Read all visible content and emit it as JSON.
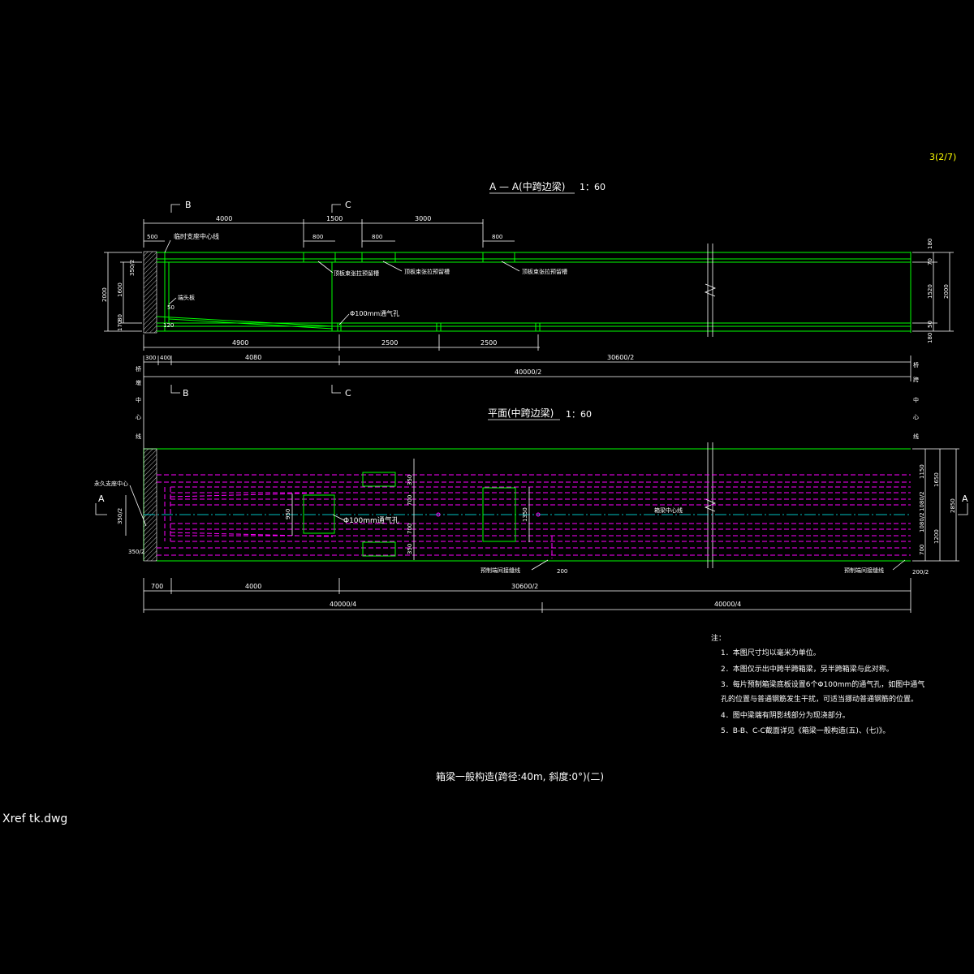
{
  "sheet_number": "3(2/7)",
  "section_aa": {
    "title": "A — A(中跨边梁)",
    "scale": "1：60"
  },
  "plan": {
    "title": "平面(中跨边梁)",
    "scale": "1：60"
  },
  "section_marks": {
    "b": "B",
    "c": "C",
    "a": "A"
  },
  "elevation_top_dims": [
    "4000",
    "1500",
    "3000"
  ],
  "elevation_sub_dims": [
    "500",
    "800",
    "800",
    "800"
  ],
  "elevation_labels": {
    "support_centerline": "临时支座中心线",
    "top_tendon_notch_1": "顶板束张拉预留槽",
    "top_tendon_notch_2": "顶板束张拉预留槽",
    "top_tendon_notch_3": "顶板束张拉预留槽",
    "end_diaphragm": "端头板",
    "vent_hole": "Φ100mm通气孔"
  },
  "elevation_left_dims": [
    "2000",
    "1600",
    "350/2",
    "120",
    "170",
    "80",
    "50",
    "120"
  ],
  "elevation_right_dims": [
    "180",
    "70",
    "1520",
    "2000",
    "50",
    "180"
  ],
  "elevation_bottom_dims": [
    "4900",
    "2500",
    "2500"
  ],
  "elevation_bottom_dims_2": [
    "300",
    "400",
    "4080",
    "30600/2"
  ],
  "elevation_total": "40000/2",
  "centerline_left": [
    "桥",
    "墩",
    "中",
    "心",
    "线"
  ],
  "centerline_right": [
    "桥",
    "跨",
    "中",
    "心",
    "线"
  ],
  "plan_labels": {
    "permanent_support_center": "永久支座中心",
    "vent_hole": "Φ100mm通气孔",
    "beam_centerline": "箱梁中心线",
    "precast_joint_1": "预制端间接缝线",
    "precast_joint_2": "预制端间接缝线"
  },
  "plan_inner_dims": [
    "950",
    "350",
    "700",
    "700",
    "350",
    "1350",
    "200"
  ],
  "plan_left_dims": [
    "350/2",
    "350/2"
  ],
  "plan_right_dims": [
    "1150",
    "1650",
    "1080/2",
    "1080/2",
    "2850",
    "1200",
    "700",
    "200/2"
  ],
  "plan_bottom_dims": [
    "700",
    "4000",
    "30600/2"
  ],
  "plan_total": [
    "40000/4",
    "40000/4"
  ],
  "notes": {
    "heading": "注：",
    "items": [
      "1．本图尺寸均以毫米为单位。",
      "2．本图仅示出中跨半跨箱梁，另半跨箱梁与此对称。",
      "3．每片预制箱梁底板设置6个Φ100mm的通气孔，如图中通气",
      "   孔的位置与普通钢筋发生干扰，可适当挪动普通钢筋的位置。",
      "4．图中梁端有阴影线部分为现浇部分。",
      "5．B-B、C-C截面详见《箱梁一般构造(五)、(七)》。"
    ]
  },
  "drawing_title": "箱梁一般构造(跨径:40m, 斜度:0°)(二)",
  "xref_label": "Xref tk.dwg",
  "colors": {
    "background": "#000000",
    "outline": "#00ff00",
    "tendon": "#ff00ff",
    "centerline": "#00ffff",
    "sheet_no": "#ffff00",
    "text": "#ffffff"
  }
}
